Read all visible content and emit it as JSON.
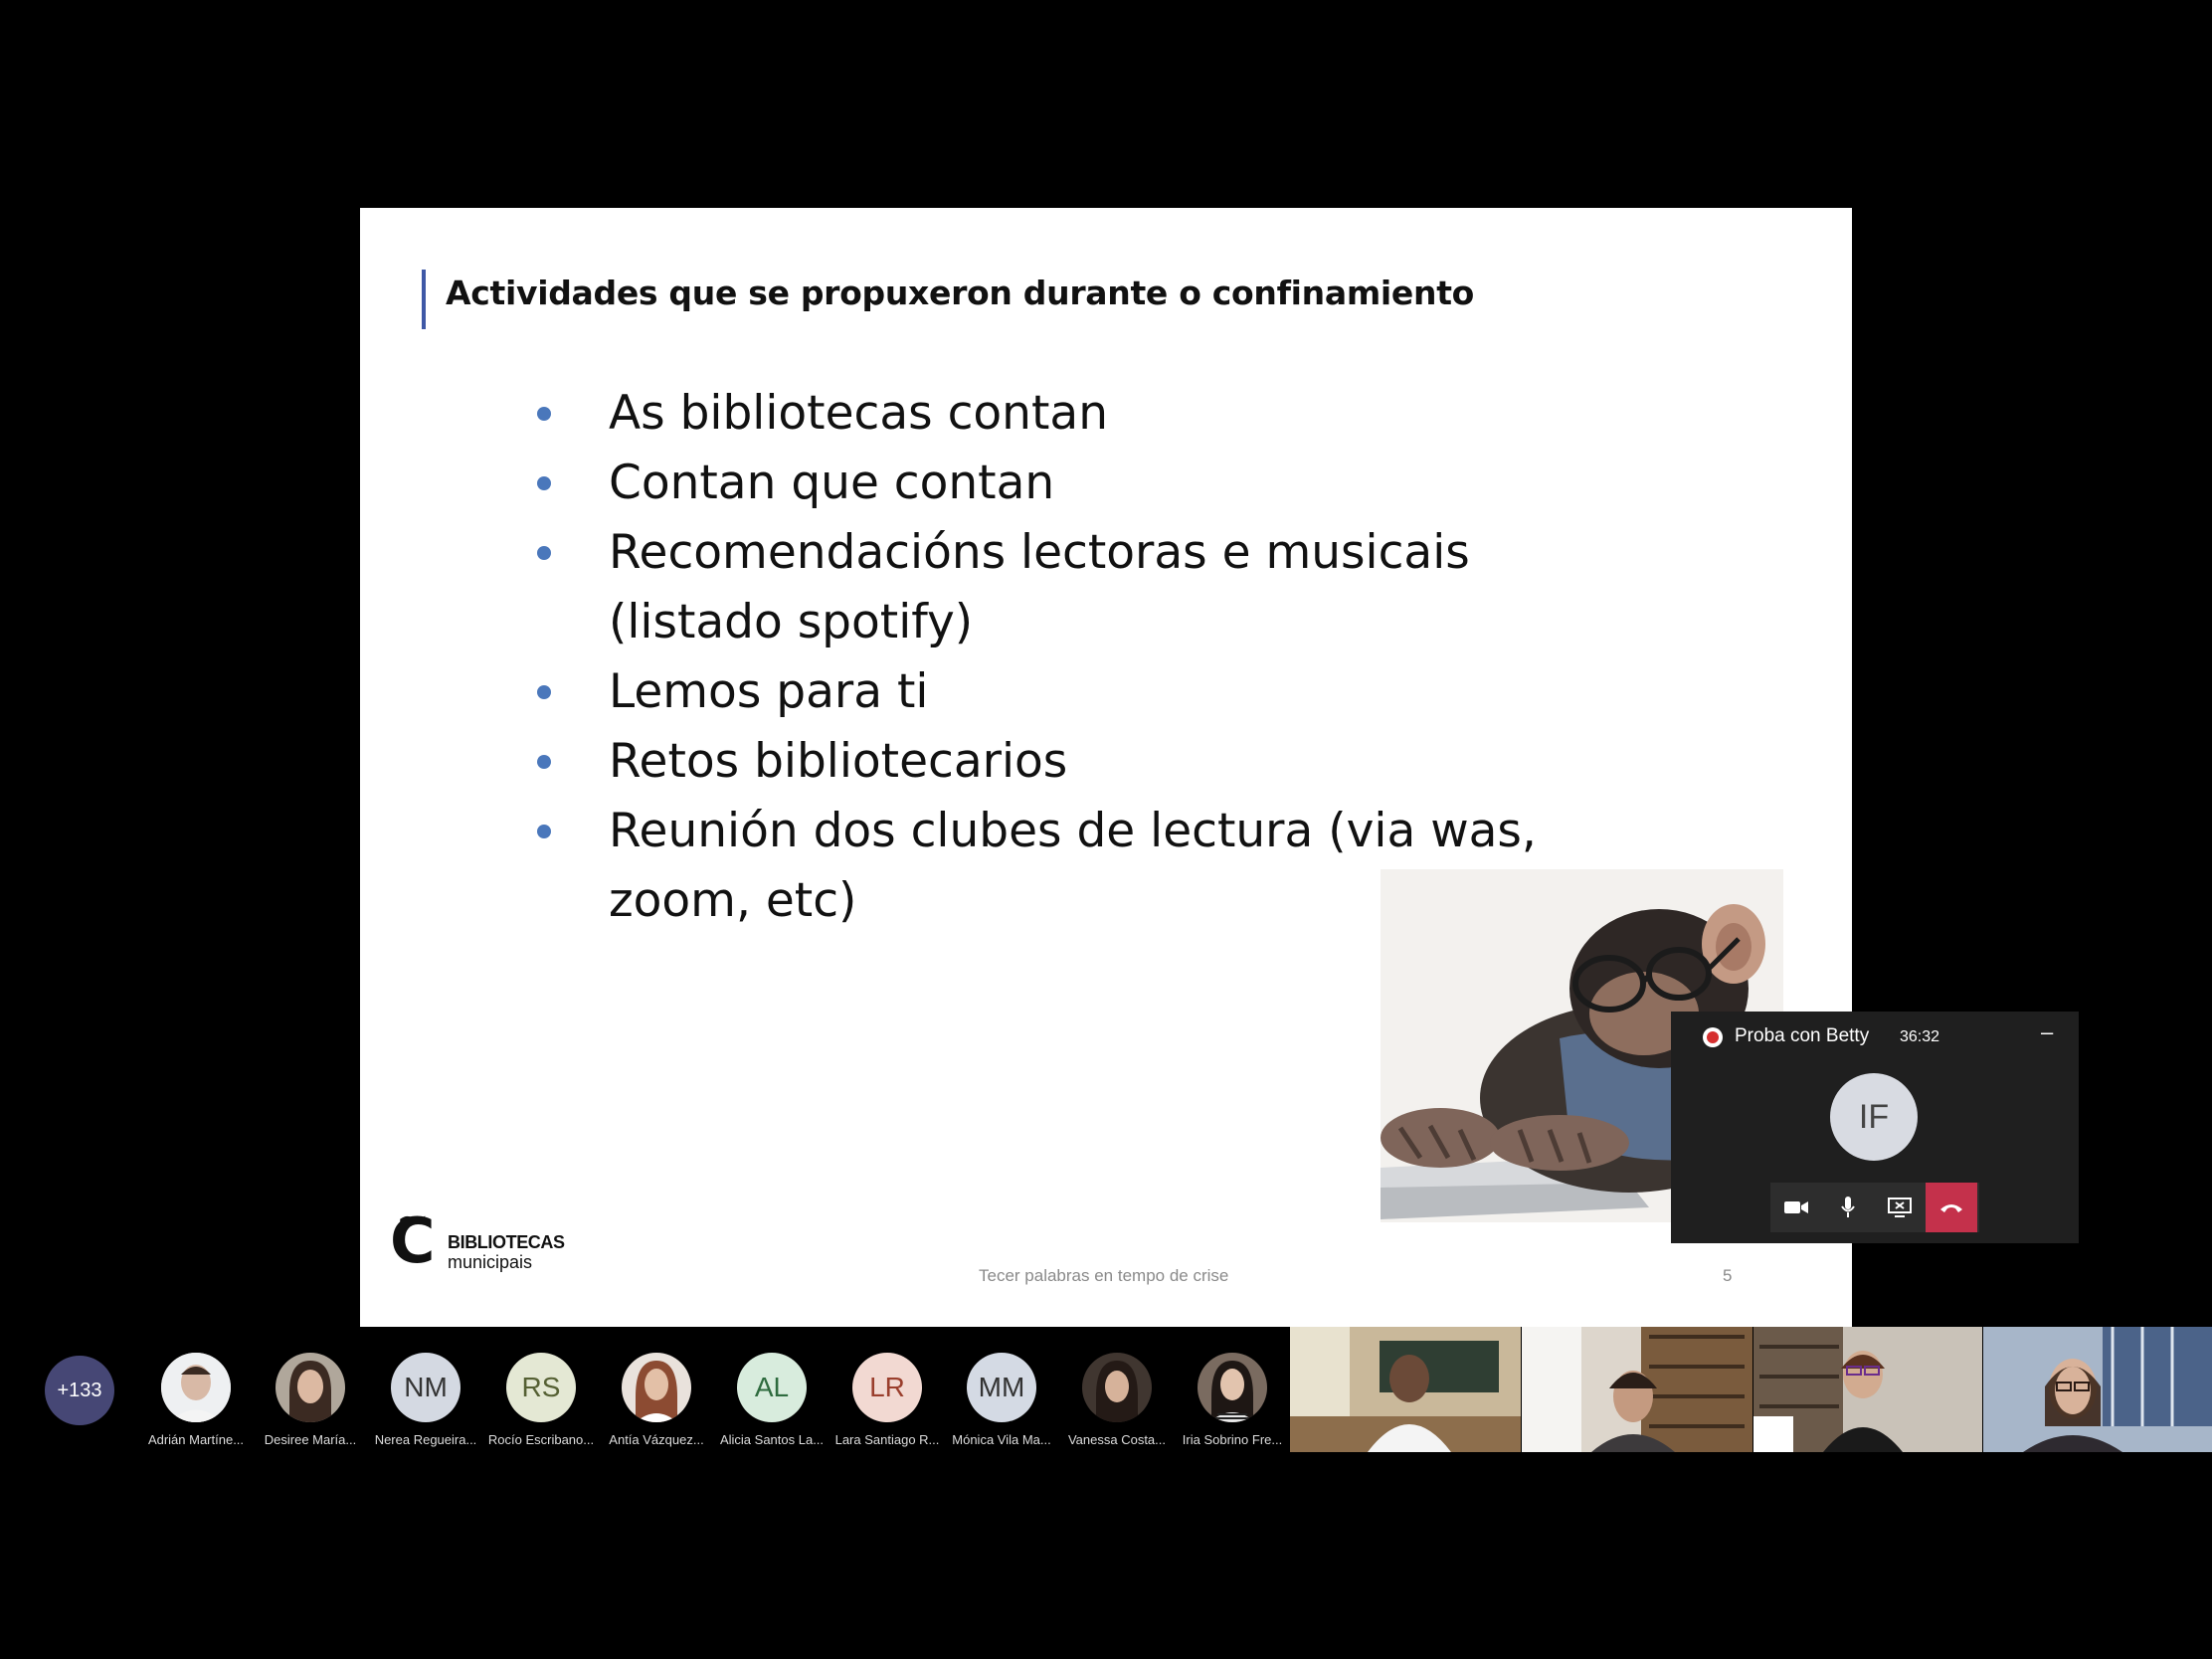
{
  "slide": {
    "title": "Actividades que se propuxeron durante o confinamiento",
    "bullets": [
      "As bibliotecas contan",
      "Contan que contan",
      "Recomendacións  lectoras e musicais (listado spotify)",
      "Lemos para ti",
      "Retos bibliotecarios",
      "Reunión dos clubes de lectura (via was, zoom, etc)"
    ],
    "logo_name": "BIBLIOTECAS",
    "logo_sub": "municipais",
    "footer_text": "Tecer palabras en tempo de crise",
    "page_number": "5",
    "image_subject": "chimpanzee-with-glasses-typing-on-laptop"
  },
  "mini_window": {
    "title": "Proba con Betty",
    "elapsed": "36:32",
    "minimize_label": "–",
    "avatar_initials": "IF",
    "controls": [
      "camera-icon",
      "mic-icon",
      "share-screen-icon",
      "hang-up-icon"
    ],
    "hangup_color": "#c4314b",
    "recording_color": "#d63030"
  },
  "participants": {
    "more_count": "+133",
    "people": [
      {
        "name": "Adrián Martíne...",
        "initials": "",
        "photo": true,
        "bg": "#c9c4bf"
      },
      {
        "name": "Desiree María...",
        "initials": "",
        "photo": true,
        "bg": "#8a7a6c"
      },
      {
        "name": "Nerea Regueira...",
        "initials": "NM",
        "photo": false,
        "bg": "#d4d9e2"
      },
      {
        "name": "Rocío Escribano...",
        "initials": "RS",
        "photo": false,
        "bg": "#e4e8d4"
      },
      {
        "name": "Antía Vázquez...",
        "initials": "",
        "photo": true,
        "bg": "#c08a72"
      },
      {
        "name": "Alicia Santos La...",
        "initials": "AL",
        "photo": false,
        "bg": "#d8ecdd"
      },
      {
        "name": "Lara Santiago R...",
        "initials": "LR",
        "photo": false,
        "bg": "#f2d9d2"
      },
      {
        "name": "Mónica Vila Ma...",
        "initials": "MM",
        "photo": false,
        "bg": "#d4dae4"
      },
      {
        "name": "Vanessa Costa...",
        "initials": "",
        "photo": true,
        "bg": "#4a3c34"
      },
      {
        "name": "Iria Sobrino Fre...",
        "initials": "",
        "photo": true,
        "bg": "#6a5a50"
      }
    ]
  },
  "video_tiles": [
    {
      "name": "video-participant-1",
      "scene": "classroom"
    },
    {
      "name": "video-participant-2",
      "scene": "bookshelf"
    },
    {
      "name": "video-participant-3",
      "scene": "bookshelf-glasses"
    },
    {
      "name": "video-participant-4",
      "scene": "window-room"
    }
  ]
}
